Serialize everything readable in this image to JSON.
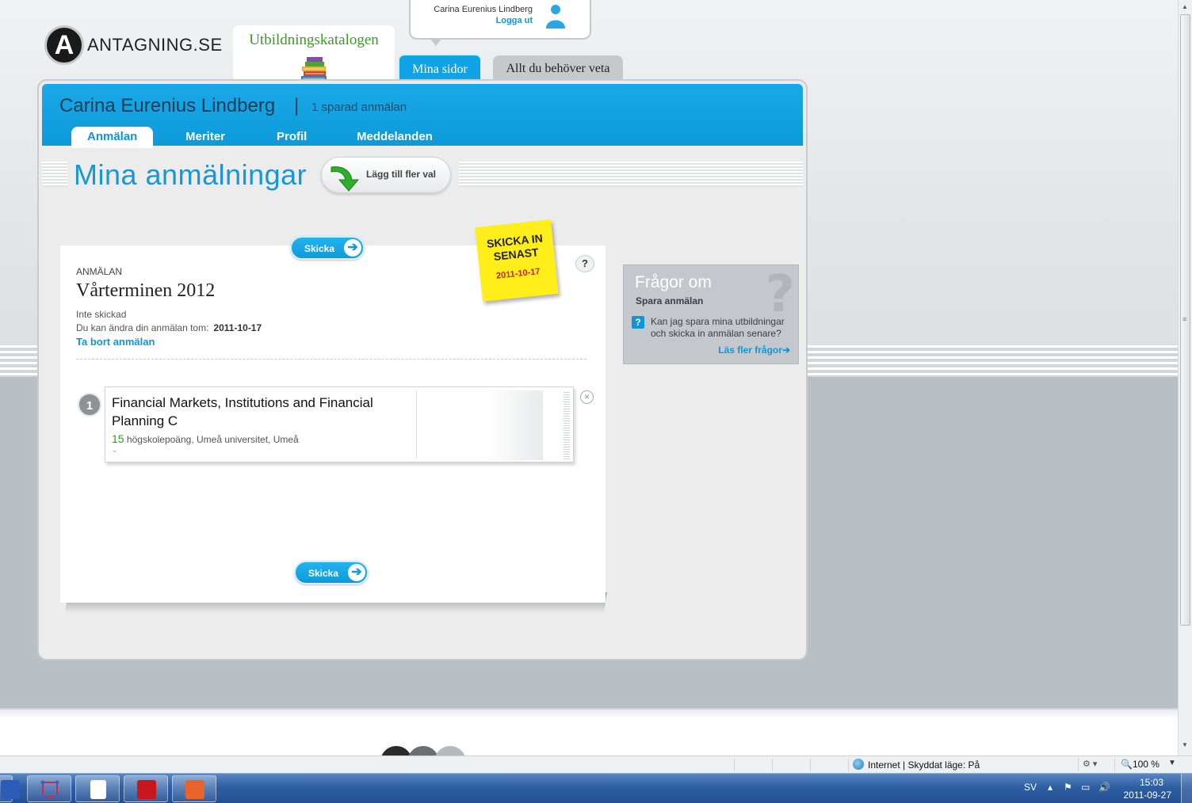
{
  "brand": {
    "logo_letter": "A",
    "logo_text": "ANTAGNING.SE"
  },
  "top_tabs": {
    "katalog": "Utbildningskatalogen",
    "mina_sidor": "Mina sidor",
    "allt": "Allt du behöver veta"
  },
  "user": {
    "name": "Carina Eurenius Lindberg",
    "logout": "Logga ut"
  },
  "header": {
    "name": "Carina Eurenius Lindberg",
    "separator": "|",
    "saved": "1 sparad anmälan",
    "nav": [
      "Anmälan",
      "Meriter",
      "Profil",
      "Meddelanden"
    ]
  },
  "page": {
    "title": "Mina anmälningar",
    "add_more": "Lägg till fler val"
  },
  "application": {
    "kicker": "ANMÄLAN",
    "term": "Vårterminen 2012",
    "status": "Inte skickad",
    "change_label": "Du kan ändra din anmälan tom:",
    "change_date": "2011-10-17",
    "remove": "Ta bort anmälan",
    "send": "Skicka",
    "help": "?",
    "course": {
      "number": "1",
      "name": "Financial Markets, Institutions and Financial Planning C",
      "points": "15",
      "details": "högskolepoäng, Umeå universitet, Umeå"
    }
  },
  "sticky": {
    "line1": "SKICKA IN",
    "line2": "SENAST",
    "date": "2011-10-17"
  },
  "faq": {
    "title": "Frågor om",
    "subtitle": "Spara anmälan",
    "question": "Kan jag spara mina utbildningar och skicka in anmälan senare?",
    "more": "Läs fler frågor"
  },
  "statusbar": {
    "zone": "Internet | Skyddat läge: På",
    "zoom": "100 %"
  },
  "taskbar": {
    "lang": "SV",
    "time": "15:03",
    "date": "2011-09-27"
  },
  "colors": {
    "accent": "#10a4e6",
    "green": "#3a9a22",
    "sticky": "#ffee1a",
    "deadline": "#c0271d"
  }
}
